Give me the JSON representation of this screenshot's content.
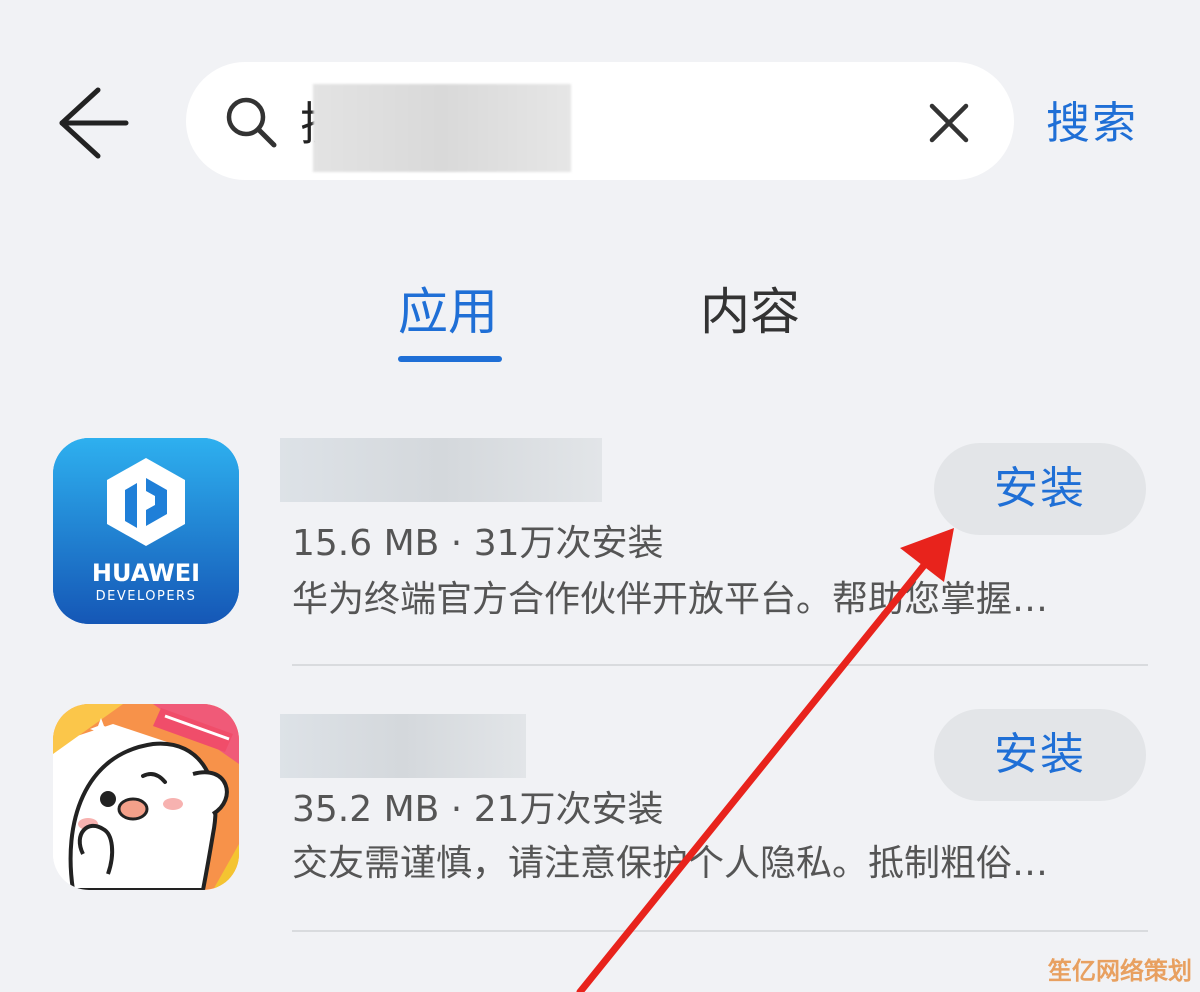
{
  "header": {
    "back_icon": "back-arrow-icon",
    "search_icon": "search-icon",
    "search_first_char": "搜",
    "search_query": "",
    "clear_icon": "close-icon",
    "search_button": "搜索"
  },
  "tabs": [
    {
      "label": "应用",
      "active": true
    },
    {
      "label": "内容",
      "active": false
    }
  ],
  "apps": [
    {
      "name": "",
      "icon": "huawei-developers-logo",
      "icon_text_1": "HUAWEI",
      "icon_text_2": "DEVELOPERS",
      "meta": "15.6 MB · 31万次安装",
      "description": "华为终端官方合作伙伴开放平台。帮助您掌握…",
      "install_label": "安装"
    },
    {
      "name": "",
      "icon": "ghost-mascot-icon",
      "meta": "35.2 MB · 21万次安装",
      "description": "交友需谨慎，请注意保护个人隐私。抵制粗俗…",
      "install_label": "安装"
    }
  ],
  "watermark": "笙亿网络策划",
  "colors": {
    "accent": "#1f6fd6",
    "background": "#f1f2f5",
    "annotation_arrow": "#e8231c"
  }
}
